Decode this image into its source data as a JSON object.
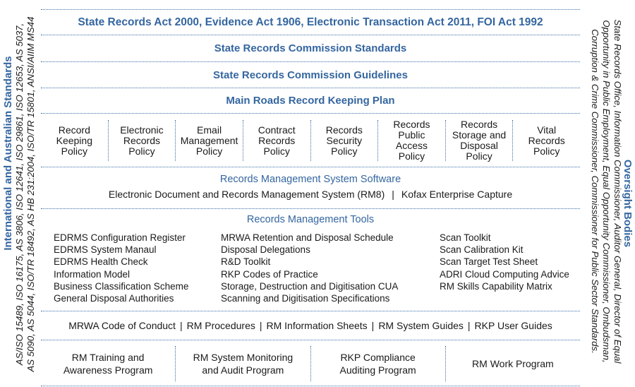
{
  "colors": {
    "heading": "#3466a0",
    "rule": "#3a6ea5",
    "text": "#1a1a1a"
  },
  "left_panel": {
    "title": "International and Australian Standards",
    "lines": [
      "AS/ISO 15489, ISO 16175, AS 3806, ISO 12641, ISO 29861, ISO 12653, AS 5037,",
      "AS 5090, AS 5044, ISO/TR 18492, AS HB 231:2004, ISO/TR 15801, ANSI/AIIM MS44"
    ]
  },
  "right_panel": {
    "title": "Oversight Bodies",
    "lines": [
      "State Records Office, Information Commissioner, Auditor General, Director of Equal",
      "Opportunity in Public Employment, Equal Opportunity Commissioner, Ombudsman,",
      "Corruption & Crime Commissioner, Commissioner for Public Sector Standards."
    ]
  },
  "legislation": "State Records Act 2000, Evidence Act 1906, Electronic Transaction Act 2011, FOI Act 1992",
  "standards": "State Records Commission Standards",
  "guidelines": "State Records Commission Guidelines",
  "plan": "Main Roads Record Keeping Plan",
  "policies": [
    [
      "Record",
      "Keeping",
      "Policy"
    ],
    [
      "Electronic",
      "Records",
      "Policy"
    ],
    [
      "Email",
      "Management",
      "Policy"
    ],
    [
      "Contract",
      "Records",
      "Policy"
    ],
    [
      "Records",
      "Security",
      "Policy"
    ],
    [
      "Records",
      "Public",
      "Access",
      "Policy"
    ],
    [
      "Records",
      "Storage and",
      "Disposal",
      "Policy"
    ],
    [
      "Vital",
      "Records",
      "Policy"
    ]
  ],
  "software": {
    "title": "Records Management System Software",
    "items": [
      "Electronic Document and Records Management System (RM8)",
      "Kofax Enterprise Capture"
    ],
    "separator": "|"
  },
  "tools": {
    "title": "Records Management Tools",
    "columns": [
      [
        "EDRMS Configuration Register",
        "EDRMS System Manaul",
        "EDRMS Health Check",
        "Information Model",
        "Business Classification Scheme",
        "General Disposal Authorities"
      ],
      [
        "MRWA Retention and Disposal Schedule",
        "Disposal Delegations",
        "R&D Toolkit",
        "RKP Codes of Practice",
        "Storage, Destruction and Digitisation CUA",
        "Scanning and Digitisation Specifications"
      ],
      [
        "Scan Toolkit",
        "Scan Calibration Kit",
        "Scan Target Test Sheet",
        "ADRI Cloud Computing Advice",
        "RM Skills Capability Matrix"
      ]
    ]
  },
  "guides": {
    "items": [
      "MRWA Code of Conduct",
      "RM Procedures",
      "RM Information Sheets",
      "RM System Guides",
      "RKP User Guides"
    ],
    "separator": "|"
  },
  "programs": [
    [
      "RM Training and",
      "Awareness Program"
    ],
    [
      "RM System Monitoring",
      "and Audit Program"
    ],
    [
      "RKP Compliance",
      "Auditing Program"
    ],
    [
      "RM Work Program"
    ]
  ]
}
